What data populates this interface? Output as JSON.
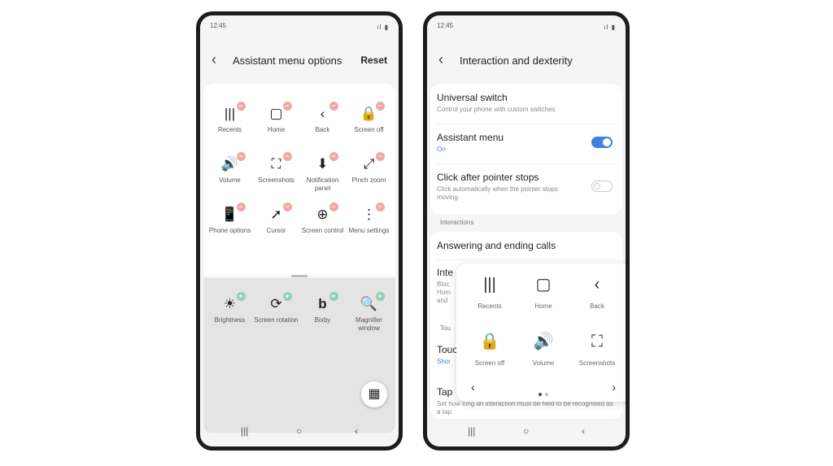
{
  "left_phone": {
    "status_time": "12:45",
    "status_icons": "ıl ▮",
    "back_icon": "‹",
    "title": "Assistant menu options",
    "reset_label": "Reset",
    "active_items": [
      {
        "label": "Recents",
        "icon": "|||"
      },
      {
        "label": "Home",
        "icon": "▢"
      },
      {
        "label": "Back",
        "icon": "‹"
      },
      {
        "label": "Screen off",
        "icon": "🔒"
      },
      {
        "label": "Volume",
        "icon": "🔊"
      },
      {
        "label": "Screenshots",
        "icon": "⛶"
      },
      {
        "label": "Notification panel",
        "icon": "⬇"
      },
      {
        "label": "Pinch zoom",
        "icon": "⤢"
      },
      {
        "label": "Phone options",
        "icon": "📱"
      },
      {
        "label": "Cursor",
        "icon": "➚"
      },
      {
        "label": "Screen control",
        "icon": "⊕"
      },
      {
        "label": "Menu settings",
        "icon": "⋮"
      }
    ],
    "available_items": [
      {
        "label": "Brightness",
        "icon": "☀"
      },
      {
        "label": "Screen rotation",
        "icon": "⟳"
      },
      {
        "label": "Bixby",
        "icon": "b"
      },
      {
        "label": "Magnifier window",
        "icon": "🔍"
      }
    ],
    "badge_minus": "−",
    "badge_plus": "+",
    "fab_icon": "▦",
    "nav": {
      "recents": "|||",
      "home": "○",
      "back": "‹"
    }
  },
  "right_phone": {
    "status_time": "12:45",
    "status_icons": "ıl ▮",
    "back_icon": "‹",
    "title": "Interaction and dexterity",
    "universal_switch": {
      "title": "Universal switch",
      "sub": "Control your phone with custom switches."
    },
    "assistant_menu": {
      "title": "Assistant menu",
      "sub": "On",
      "on": true
    },
    "click_after": {
      "title": "Click after pointer stops",
      "sub": "Click automatically when the pointer stops moving.",
      "on": false
    },
    "interactions_header": "Interactions",
    "answering": "Answering and ending calls",
    "partial_rows": {
      "row1_title": "Inte",
      "row1_sub1": "Bloc",
      "row1_sub2": "Hom",
      "row1_sub3": "and",
      "touch_header": "Tou",
      "row2_title": "Touc",
      "row2_sub": "Shor",
      "tap_title": "Tap",
      "tap_sub": "Set how long an interaction must be held to be recognised as a tap."
    },
    "popup": {
      "items": [
        {
          "label": "Recents",
          "icon": "|||"
        },
        {
          "label": "Home",
          "icon": "▢"
        },
        {
          "label": "Back",
          "icon": "‹"
        },
        {
          "label": "Screen off",
          "icon": "🔒"
        },
        {
          "label": "Volume",
          "icon": "🔊"
        },
        {
          "label": "Screenshots",
          "icon": "⛶"
        }
      ],
      "prev_icon": "‹",
      "next_icon": "›"
    },
    "nav": {
      "recents": "|||",
      "home": "○",
      "back": "‹"
    }
  }
}
